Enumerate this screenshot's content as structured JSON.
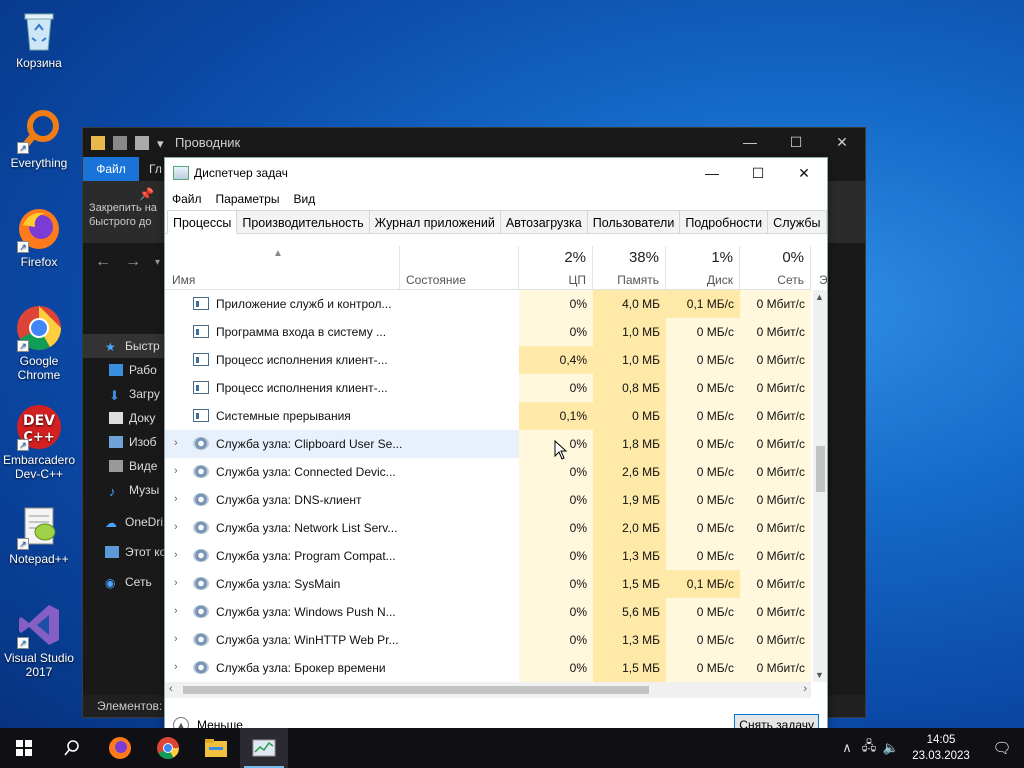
{
  "desktop": {
    "icons": [
      {
        "label": "Корзина",
        "icon": "recycle-bin-icon"
      },
      {
        "label": "Everything",
        "icon": "everything-search-icon"
      },
      {
        "label": "Firefox",
        "icon": "firefox-icon"
      },
      {
        "label": "Google Chrome",
        "icon": "chrome-icon"
      },
      {
        "label": "Embarcadero Dev-C++",
        "icon": "devcpp-icon"
      },
      {
        "label": "Notepad++",
        "icon": "notepadpp-icon"
      },
      {
        "label": "Visual Studio 2017",
        "icon": "visual-studio-icon"
      }
    ]
  },
  "explorer": {
    "title": "Проводник",
    "ribbon_tab_file": "Файл",
    "ribbon_tab_other": "Гл",
    "ribbon_pin_text": "Закрепить на быстрого до",
    "side_items": [
      {
        "label": "Быстр",
        "icon": "star-icon"
      },
      {
        "label": "Рабо",
        "icon": "desktop-folder-icon"
      },
      {
        "label": "Загру",
        "icon": "downloads-icon"
      },
      {
        "label": "Доку",
        "icon": "documents-icon"
      },
      {
        "label": "Изоб",
        "icon": "pictures-icon"
      },
      {
        "label": "Виде",
        "icon": "videos-icon"
      },
      {
        "label": "Музы",
        "icon": "music-icon"
      },
      {
        "label": "OneDri",
        "icon": "onedrive-icon"
      },
      {
        "label": "Этот ко",
        "icon": "this-pc-icon"
      },
      {
        "label": "Сеть",
        "icon": "network-icon"
      }
    ],
    "status": "Элементов:"
  },
  "taskmgr": {
    "title": "Диспетчер задач",
    "menu": [
      "Файл",
      "Параметры",
      "Вид"
    ],
    "tabs": [
      "Процессы",
      "Производительность",
      "Журнал приложений",
      "Автозагрузка",
      "Пользователи",
      "Подробности",
      "Службы"
    ],
    "columns": {
      "name": "Имя",
      "state": "Состояние",
      "cpu_pct": "2%",
      "cpu": "ЦП",
      "mem_pct": "38%",
      "mem": "Память",
      "disk_pct": "1%",
      "disk": "Диск",
      "net_pct": "0%",
      "net": "Сеть",
      "extra": "Э"
    },
    "rows": [
      {
        "name": "Приложение служб и контрол...",
        "cpu": "0%",
        "mem": "4,0 МБ",
        "disk": "0,1 МБ/с",
        "net": "0 Мбит/с",
        "icon": "window-icon",
        "expandable": false
      },
      {
        "name": "Программа входа в систему ...",
        "cpu": "0%",
        "mem": "1,0 МБ",
        "disk": "0 МБ/с",
        "net": "0 Мбит/с",
        "icon": "window-icon",
        "expandable": false
      },
      {
        "name": "Процесс исполнения клиент-...",
        "cpu": "0,4%",
        "mem": "1,0 МБ",
        "disk": "0 МБ/с",
        "net": "0 Мбит/с",
        "icon": "window-icon",
        "expandable": false
      },
      {
        "name": "Процесс исполнения клиент-...",
        "cpu": "0%",
        "mem": "0,8 МБ",
        "disk": "0 МБ/с",
        "net": "0 Мбит/с",
        "icon": "window-icon",
        "expandable": false
      },
      {
        "name": "Системные прерывания",
        "cpu": "0,1%",
        "mem": "0 МБ",
        "disk": "0 МБ/с",
        "net": "0 Мбит/с",
        "icon": "window-icon",
        "expandable": false
      },
      {
        "name": "Служба узла: Clipboard User Se...",
        "cpu": "0%",
        "mem": "1,8 МБ",
        "disk": "0 МБ/с",
        "net": "0 Мбит/с",
        "icon": "gear-icon",
        "expandable": true
      },
      {
        "name": "Служба узла: Connected Devic...",
        "cpu": "0%",
        "mem": "2,6 МБ",
        "disk": "0 МБ/с",
        "net": "0 Мбит/с",
        "icon": "gear-icon",
        "expandable": true
      },
      {
        "name": "Служба узла: DNS-клиент",
        "cpu": "0%",
        "mem": "1,9 МБ",
        "disk": "0 МБ/с",
        "net": "0 Мбит/с",
        "icon": "gear-icon",
        "expandable": true
      },
      {
        "name": "Служба узла: Network List Serv...",
        "cpu": "0%",
        "mem": "2,0 МБ",
        "disk": "0 МБ/с",
        "net": "0 Мбит/с",
        "icon": "gear-icon",
        "expandable": true
      },
      {
        "name": "Служба узла: Program Compat...",
        "cpu": "0%",
        "mem": "1,3 МБ",
        "disk": "0 МБ/с",
        "net": "0 Мбит/с",
        "icon": "gear-icon",
        "expandable": true
      },
      {
        "name": "Служба узла: SysMain",
        "cpu": "0%",
        "mem": "1,5 МБ",
        "disk": "0,1 МБ/с",
        "net": "0 Мбит/с",
        "icon": "gear-icon",
        "expandable": true
      },
      {
        "name": "Служба узла: Windows Push N...",
        "cpu": "0%",
        "mem": "5,6 МБ",
        "disk": "0 МБ/с",
        "net": "0 Мбит/с",
        "icon": "gear-icon",
        "expandable": true
      },
      {
        "name": "Служба узла: WinHTTP Web Pr...",
        "cpu": "0%",
        "mem": "1,3 МБ",
        "disk": "0 МБ/с",
        "net": "0 Мбит/с",
        "icon": "gear-icon",
        "expandable": true
      },
      {
        "name": "Служба узла: Брокер времени",
        "cpu": "0%",
        "mem": "1,5 МБ",
        "disk": "0 МБ/с",
        "net": "0 Мбит/с",
        "icon": "gear-icon",
        "expandable": true
      }
    ],
    "footer_less": "Меньше",
    "end_task": "Снять задачу"
  },
  "taskbar": {
    "time": "14:05",
    "date": "23.03.2023",
    "apps": [
      "start-icon",
      "search-icon",
      "firefox-icon",
      "chrome-icon",
      "file-explorer-icon",
      "task-manager-icon"
    ]
  },
  "colors": {
    "accent": "#0078d7",
    "heat_light": "#fff4c4",
    "heat_mid": "#ffe9a8",
    "taskbar": "#0f0f14"
  }
}
